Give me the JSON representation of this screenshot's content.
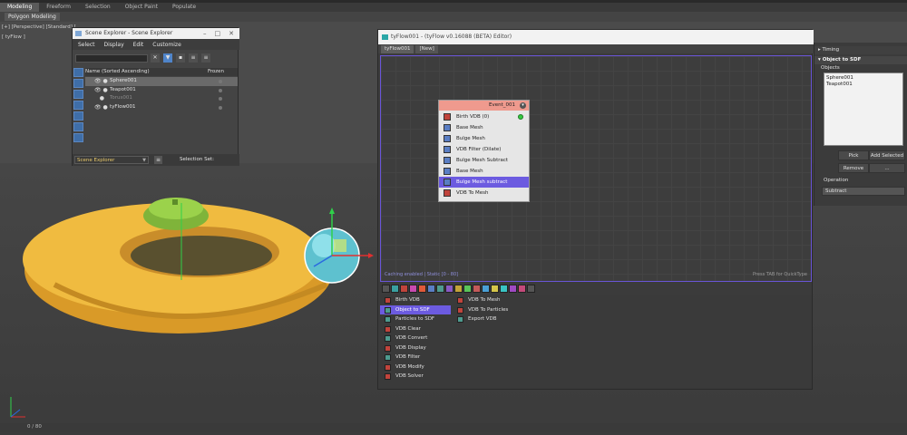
{
  "ribbon": {
    "tabs": [
      "Modeling",
      "Freeform",
      "Selection",
      "Object Paint",
      "Populate"
    ],
    "sub_label": "Polygon Modeling"
  },
  "viewport": {
    "label": "[+] [Perspective] [Standard] [",
    "label2": "[ tyFlow ]"
  },
  "timeline": {
    "label": "0 / 80"
  },
  "scene_explorer": {
    "title": "Scene Explorer - Scene Explorer",
    "menu": [
      "Select",
      "Display",
      "Edit",
      "Customize"
    ],
    "columns": {
      "name": "Name (Sorted Ascending)",
      "frozen": "Frozen"
    },
    "rows": [
      {
        "name": "Sphere001",
        "selected": true,
        "hidden": false
      },
      {
        "name": "Teapot001",
        "selected": false,
        "hidden": false
      },
      {
        "name": "Torus001",
        "selected": false,
        "hidden": true
      },
      {
        "name": "tyFlow001",
        "selected": false,
        "hidden": false
      }
    ],
    "dropdown": "Scene Explorer",
    "selection_sets_label": "Selection Set:"
  },
  "tyflow": {
    "title": "tyFlow001 - (tyFlow v0.16088 (BETA) Editor)",
    "tabs": [
      "tyFlow001",
      "[New]"
    ],
    "caching_status": "Caching enabled | Static [0 - 80]",
    "hint": "Press TAB for QuickType",
    "event": {
      "name": "Event_001",
      "operators": [
        {
          "label": "Birth VDB (0)",
          "kind": "birth"
        },
        {
          "label": "Base Mesh",
          "kind": "vdb"
        },
        {
          "label": "Bulge Mesh",
          "kind": "vdb"
        },
        {
          "label": "VDB Filter (Dilate)",
          "kind": "vdb"
        },
        {
          "label": "Bulge Mesh Subtract",
          "kind": "vdb"
        },
        {
          "label": "Base Mesh",
          "kind": "vdb"
        },
        {
          "label": "Bulge Mesh subtract",
          "kind": "vdb",
          "selected": true
        },
        {
          "label": "VDB To Mesh",
          "kind": "birth"
        }
      ]
    },
    "palette": {
      "col1": [
        {
          "label": "Birth VDB"
        },
        {
          "label": "Object to SDF",
          "selected": true
        },
        {
          "label": "Particles to SDF"
        },
        {
          "label": "VDB Clear"
        },
        {
          "label": "VDB Convert"
        },
        {
          "label": "VDB Display"
        },
        {
          "label": "VDB Filter"
        },
        {
          "label": "VDB Modify"
        },
        {
          "label": "VDB Solver"
        }
      ],
      "col2": [
        {
          "label": "VDB To Mesh"
        },
        {
          "label": "VDB To Particles"
        },
        {
          "label": "Export VDB"
        }
      ]
    }
  },
  "right_panel": {
    "timing": "Timing",
    "section": "Object to SDF",
    "objects_label": "Objects",
    "objects": [
      "Sphere001",
      "Teapot001"
    ],
    "pick": "Pick",
    "add_selected": "Add Selected",
    "remove": "Remove",
    "more": "...",
    "operation_label": "Operation",
    "operation_value": "Subtract"
  },
  "colors": {
    "accent": "#6c5be0",
    "event_header": "#ef9a8e",
    "torus": "#e8b23a",
    "sphere": "#6fd0dc",
    "teapot": "#86c240"
  }
}
